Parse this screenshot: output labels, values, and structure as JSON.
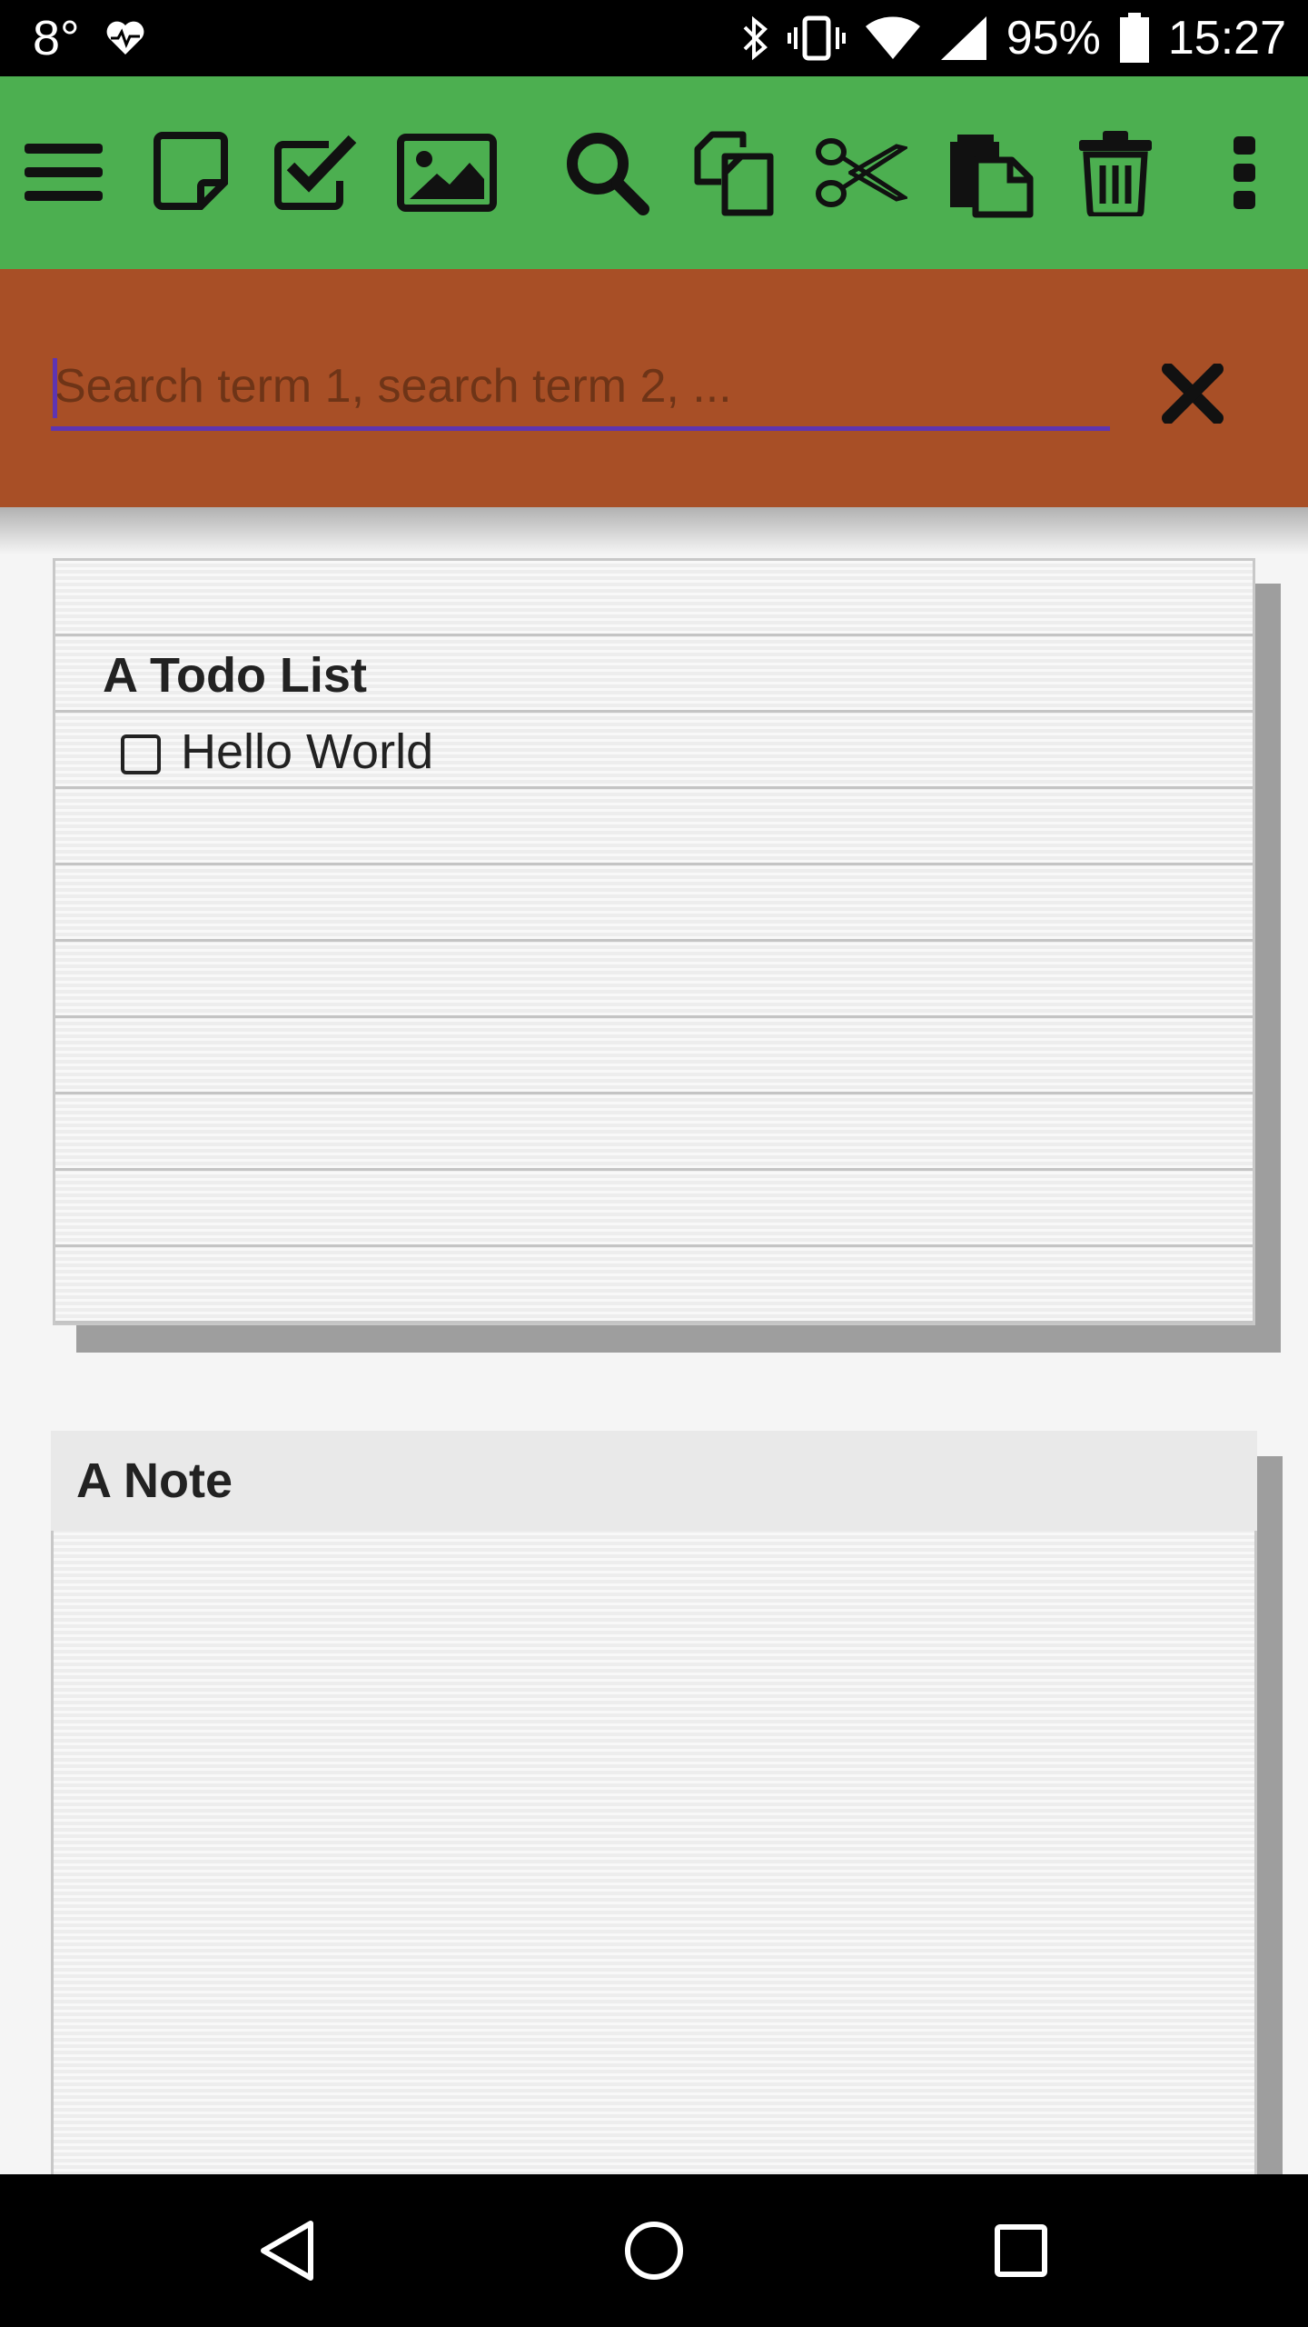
{
  "status_bar": {
    "temperature": "8°",
    "battery_percent": "95%",
    "time": "15:27"
  },
  "toolbar": {
    "background": "#4caf50",
    "icons": [
      "menu-icon",
      "note-icon",
      "checklist-icon",
      "image-icon",
      "search-icon",
      "copy-icon",
      "cut-icon",
      "paste-icon",
      "delete-icon",
      "more-vert-icon"
    ]
  },
  "search": {
    "placeholder": "Search term 1, search term 2, ...",
    "value": "",
    "background": "#a84f26",
    "accent": "#5e35b1"
  },
  "todo_card": {
    "title": "A Todo List",
    "items": [
      {
        "text": "Hello World",
        "checked": false
      }
    ]
  },
  "note_card": {
    "title": "A Note"
  }
}
